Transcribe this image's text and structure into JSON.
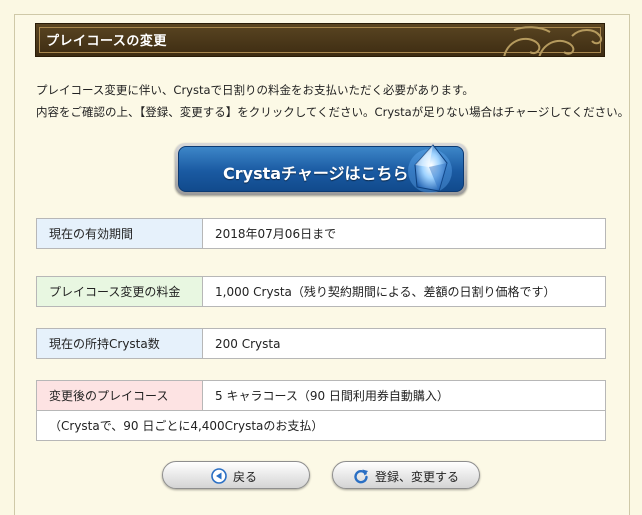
{
  "header": {
    "title": "プレイコースの変更"
  },
  "description": {
    "line1": "プレイコース変更に伴い、Crystaで日割りの料金をお支払いただく必要があります。",
    "line2": "内容をご確認の上、【登録、変更する】をクリックしてください。Crystaが足りない場合はチャージしてください。"
  },
  "charge_button": {
    "label": "Crystaチャージはこちら",
    "icon": "crystal-icon"
  },
  "info_rows": {
    "period": {
      "label": "現在の有効期間",
      "value": "2018年07月06日まで"
    },
    "fee": {
      "label": "プレイコース変更の料金",
      "value": "1,000 Crysta（残り契約期間による、差額の日割り価格です）"
    },
    "balance": {
      "label": "現在の所持Crysta数",
      "value": "200 Crysta"
    },
    "new_course": {
      "label": "変更後のプレイコース",
      "value": "5 キャラコース（90 日間利用券自動購入）",
      "note": "（Crystaで、90 日ごとに4,400Crystaのお支払）"
    }
  },
  "buttons": {
    "back": {
      "label": "戻る",
      "icon": "arrow-left-icon"
    },
    "submit": {
      "label": "登録、変更する",
      "icon": "refresh-icon"
    }
  },
  "colors": {
    "title_bg": "#4a3719",
    "charge_blue": "#1a5aa2",
    "label_blue": "#e6f1fb",
    "label_green": "#e8f7e1",
    "label_pink": "#fde3e3"
  }
}
